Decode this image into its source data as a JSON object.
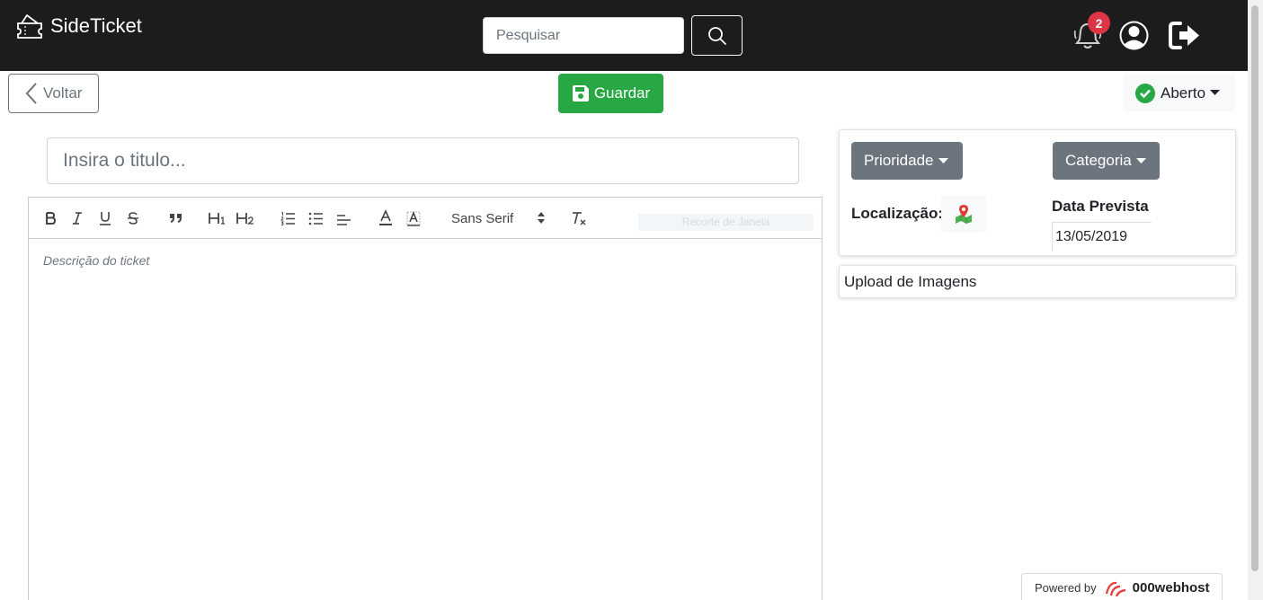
{
  "app": {
    "brand": "SideTicket"
  },
  "header": {
    "search_placeholder": "Pesquisar",
    "notifications_count": "2",
    "icons": [
      "ticket-logo-icon",
      "search-icon",
      "bell-icon",
      "user-circle-icon",
      "sign-out-icon"
    ]
  },
  "actions": {
    "back_label": "Voltar",
    "save_label": "Guardar",
    "status_label": "Aberto"
  },
  "ticket": {
    "title_placeholder": "Insira o titulo...",
    "description_placeholder": "Descrição do ticket"
  },
  "editor": {
    "font_family_label": "Sans Serif",
    "ghost_label": "Recorte de Janela",
    "tools": [
      "bold",
      "italic",
      "underline",
      "strike",
      "blockquote",
      "header-1",
      "header-2",
      "ordered-list",
      "bullet-list",
      "align",
      "text-color",
      "background-color",
      "font",
      "clean"
    ]
  },
  "details": {
    "priority_label": "Prioridade",
    "category_label": "Categoria",
    "location_label": "Localização:",
    "due_date_label": "Data Prevista",
    "due_date_value": "13/05/2019"
  },
  "upload": {
    "label": "Upload de Imagens"
  },
  "footer": {
    "powered_by": "Powered by",
    "host_brand": "000webhost"
  },
  "colors": {
    "navbar": "#1c1c1c",
    "success": "#28a745",
    "secondary": "#6c757d",
    "danger": "#dc3545"
  }
}
